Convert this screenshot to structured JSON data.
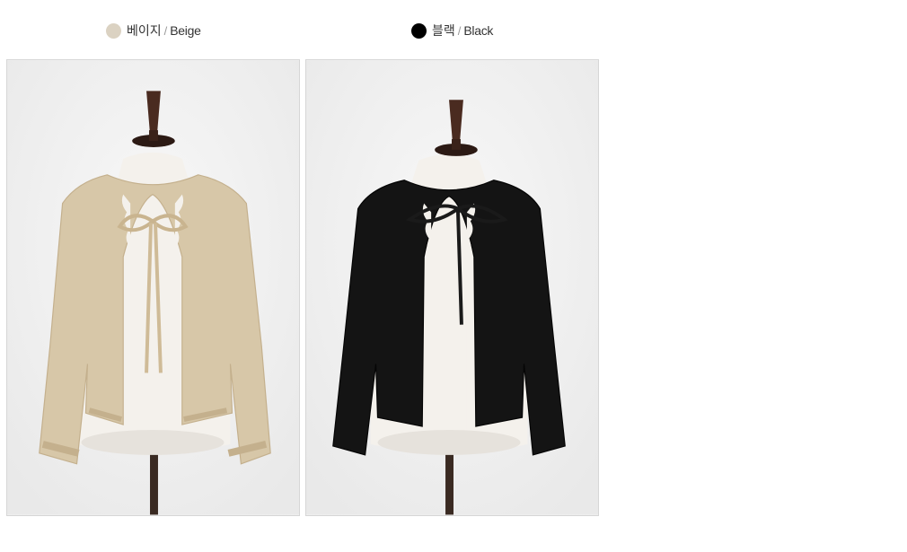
{
  "options": [
    {
      "name_ko": "베이지",
      "separator": "/",
      "name_en": "Beige",
      "swatch_color": "#dbd2c2",
      "garment_color": "#d7c7a8",
      "garment_shade": "#c4b08d"
    },
    {
      "name_ko": "블랙",
      "separator": "/",
      "name_en": "Black",
      "swatch_color": "#000000",
      "garment_color": "#141414",
      "garment_shade": "#050505"
    }
  ]
}
